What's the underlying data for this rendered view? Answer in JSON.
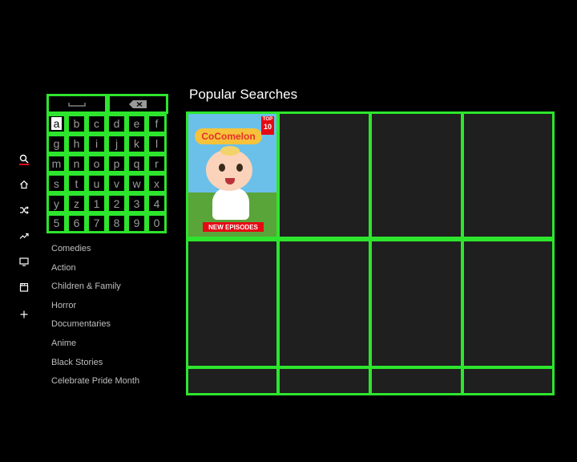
{
  "nav": {
    "items": [
      {
        "icon": "search-icon",
        "active": true
      },
      {
        "icon": "home-icon",
        "active": false
      },
      {
        "icon": "shuffle-icon",
        "active": false
      },
      {
        "icon": "trending-icon",
        "active": false
      },
      {
        "icon": "tv-icon",
        "active": false
      },
      {
        "icon": "movies-icon",
        "active": false
      },
      {
        "icon": "plus-icon",
        "active": false
      }
    ]
  },
  "keyboard": {
    "space_label": "⎵",
    "rows": [
      [
        "a",
        "b",
        "c",
        "d",
        "e",
        "f"
      ],
      [
        "g",
        "h",
        "i",
        "j",
        "k",
        "l"
      ],
      [
        "m",
        "n",
        "o",
        "p",
        "q",
        "r"
      ],
      [
        "s",
        "t",
        "u",
        "v",
        "w",
        "x"
      ],
      [
        "y",
        "z",
        "1",
        "2",
        "3",
        "4"
      ],
      [
        "5",
        "6",
        "7",
        "8",
        "9",
        "0"
      ]
    ],
    "selected": "a"
  },
  "genres": [
    "Comedies",
    "Action",
    "Children & Family",
    "Horror",
    "Documentaries",
    "Anime",
    "Black Stories",
    "Celebrate Pride Month"
  ],
  "results": {
    "title": "Popular Searches",
    "poster": {
      "logo_text": "CoComelon",
      "badge_top": "TOP",
      "badge_num": "10",
      "ribbon": "NEW EPISODES"
    }
  },
  "colors": {
    "focus_border": "#2de52d",
    "accent_red": "#e50914",
    "tile_bg": "#1f1f1f"
  }
}
